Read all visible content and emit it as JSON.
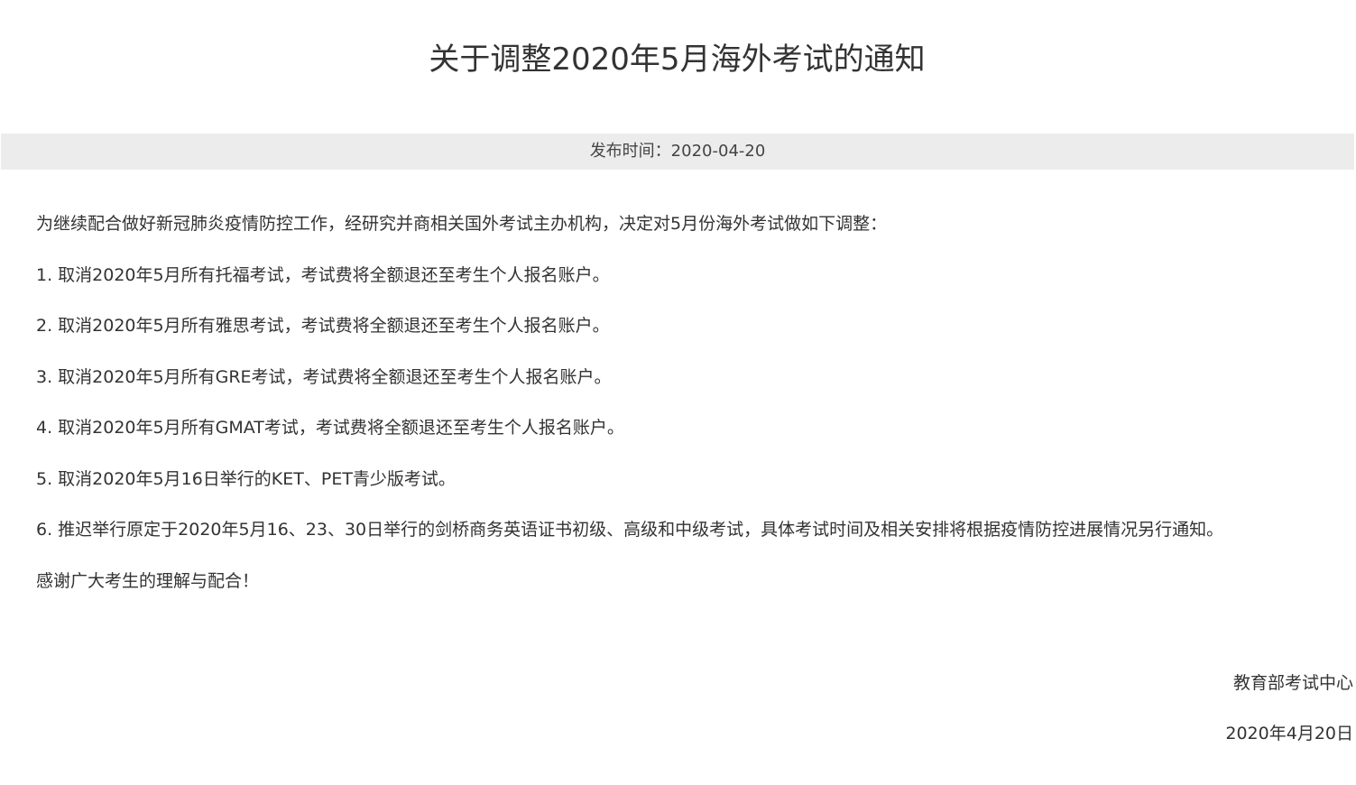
{
  "article": {
    "title": "关于调整2020年5月海外考试的通知",
    "publish_time": "发布时间：2020-04-20",
    "paragraphs": [
      "为继续配合做好新冠肺炎疫情防控工作，经研究并商相关国外考试主办机构，决定对5月份海外考试做如下调整：",
      "1. 取消2020年5月所有托福考试，考试费将全额退还至考生个人报名账户。",
      "2. 取消2020年5月所有雅思考试，考试费将全额退还至考生个人报名账户。",
      "3. 取消2020年5月所有GRE考试，考试费将全额退还至考生个人报名账户。",
      "4. 取消2020年5月所有GMAT考试，考试费将全额退还至考生个人报名账户。",
      "5. 取消2020年5月16日举行的KET、PET青少版考试。",
      "6. 推迟举行原定于2020年5月16、23、30日举行的剑桥商务英语证书初级、高级和中级考试，具体考试时间及相关安排将根据疫情防控进展情况另行通知。",
      "感谢广大考生的理解与配合！"
    ],
    "signature": {
      "organization": "教育部考试中心",
      "date": "2020年4月20日"
    }
  },
  "colors": {
    "text": "#333333",
    "meta_bar_background": "#ececec",
    "page_background": "#ffffff"
  }
}
